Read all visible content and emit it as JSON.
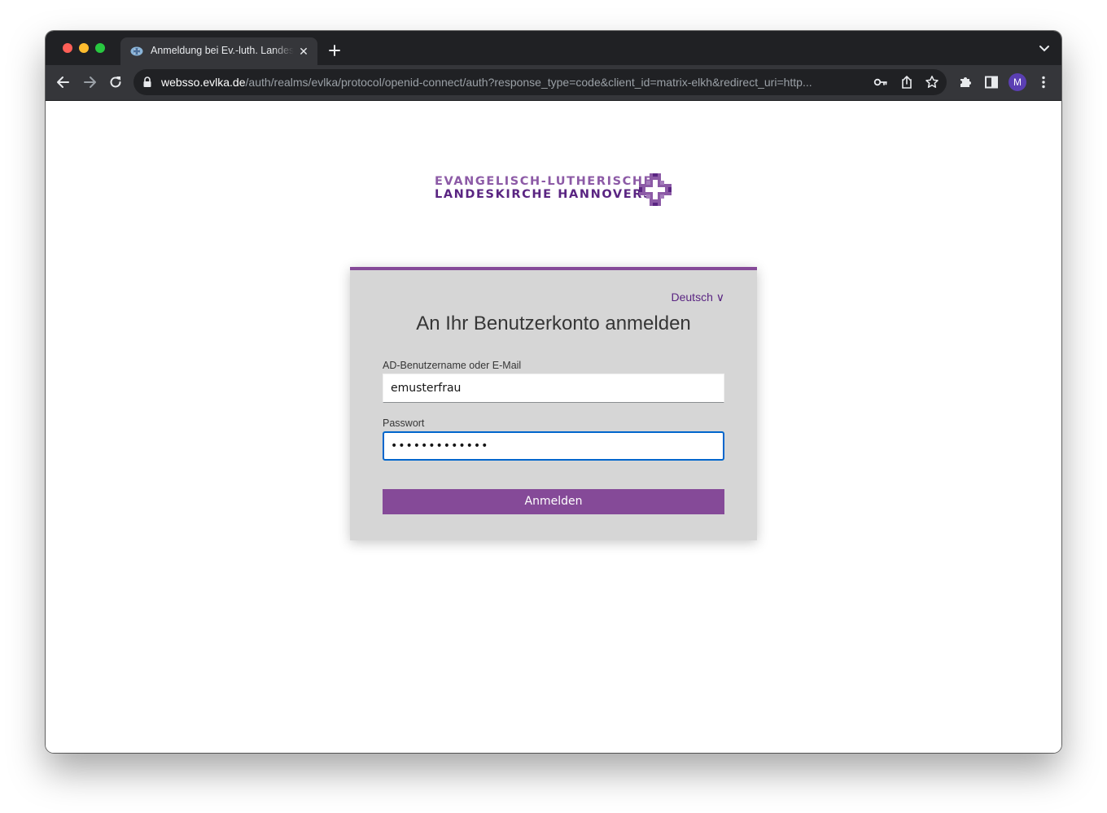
{
  "browser": {
    "tab_title": "Anmeldung bei Ev.-luth. Landeskirche Hannovers",
    "tab_close": "✕",
    "url_host": "websso.evlka.de",
    "url_path": "/auth/realms/evlka/protocol/openid-connect/auth?response_type=code&client_id=matrix-elkh&redirect_uri=http...",
    "profile_initial": "M"
  },
  "logo": {
    "line1": "EVANGELISCH-LUTHERISCHE",
    "line2": "LANDESKIRCHE HANNOVERS"
  },
  "login": {
    "language": "Deutsch ∨",
    "title": "An Ihr Benutzerkonto anmelden",
    "username_label": "AD-Benutzername oder E-Mail",
    "username_value": "emusterfrau",
    "password_label": "Passwort",
    "password_value": "•••••••••••••",
    "submit_label": "Anmelden"
  },
  "colors": {
    "accent": "#854a98",
    "brand_dark": "#5a2582",
    "focus": "#0066cc"
  }
}
